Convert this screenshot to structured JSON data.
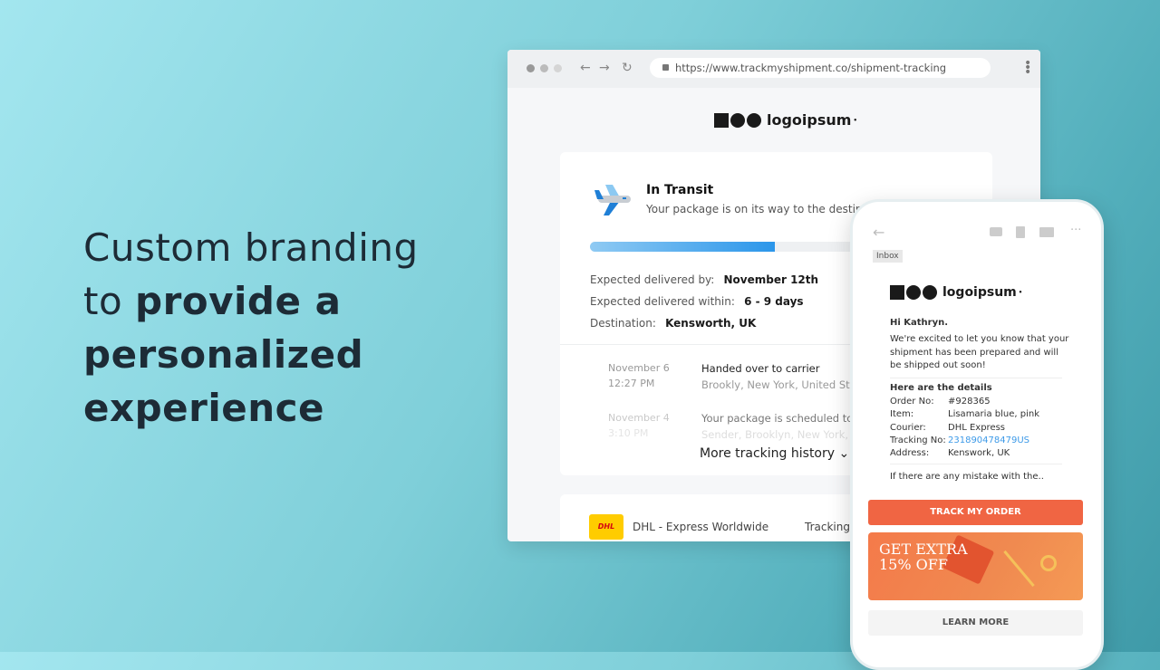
{
  "headline": {
    "line1": "Custom branding",
    "line2_pre": "to ",
    "line2_bold": "provide a",
    "line3": "personalized",
    "line4": "experience"
  },
  "browser": {
    "url": "https://www.trackmyshipment.co/shipment-tracking",
    "back": "←",
    "forward": "→",
    "reload": "↻",
    "menu": "⋮"
  },
  "brand": {
    "name": "logoipsum"
  },
  "tracking": {
    "status": "In Transit",
    "subtitle": "Your package is on its way to the destina",
    "progress_percent": 68,
    "details": [
      {
        "label": "Expected delivered by:",
        "value": "November 12th"
      },
      {
        "label": "Expected delivered within:",
        "value": "6 - 9 days"
      },
      {
        "label": "Destination:",
        "value": "Kensworth, UK"
      }
    ],
    "history": [
      {
        "date": "November 6",
        "time": "12:27 PM",
        "event": "Handed over to carrier",
        "location": "Brookly, New York, United State"
      },
      {
        "date": "November 4",
        "time": "3:10 PM",
        "event": "Your package is scheduled to b",
        "location": "Sender, Brooklyn, New York, Un"
      }
    ],
    "more_label": "More tracking history",
    "carrier": "DHL - Express Worldwide",
    "carrier_logo": "DHL",
    "tracking_label": "Tracking"
  },
  "email": {
    "inbox_label": "Inbox",
    "greeting": "Hi Kathryn.",
    "body": [
      "We're excited to let you know that your",
      "shipment has been prepared and will",
      "be shipped out soon!"
    ],
    "details_title": "Here are the details",
    "details": [
      {
        "label": "Order No:",
        "value": "#928365"
      },
      {
        "label": "Item:",
        "value": "Lisamaria blue, pink"
      },
      {
        "label": "Courier:",
        "value": "DHL Express"
      },
      {
        "label": "Tracking No:",
        "value": "231890478479US"
      },
      {
        "label": "Address:",
        "value": "Kenswork, UK"
      }
    ],
    "footer": "If there are any mistake with the..",
    "track_button": "TRACK MY ORDER",
    "promo_line1": "GET EXTRA",
    "promo_line2": "15% OFF",
    "learn_more": "LEARN MORE",
    "colors": {
      "accent": "#f06543",
      "link": "#3d9ae8"
    }
  }
}
